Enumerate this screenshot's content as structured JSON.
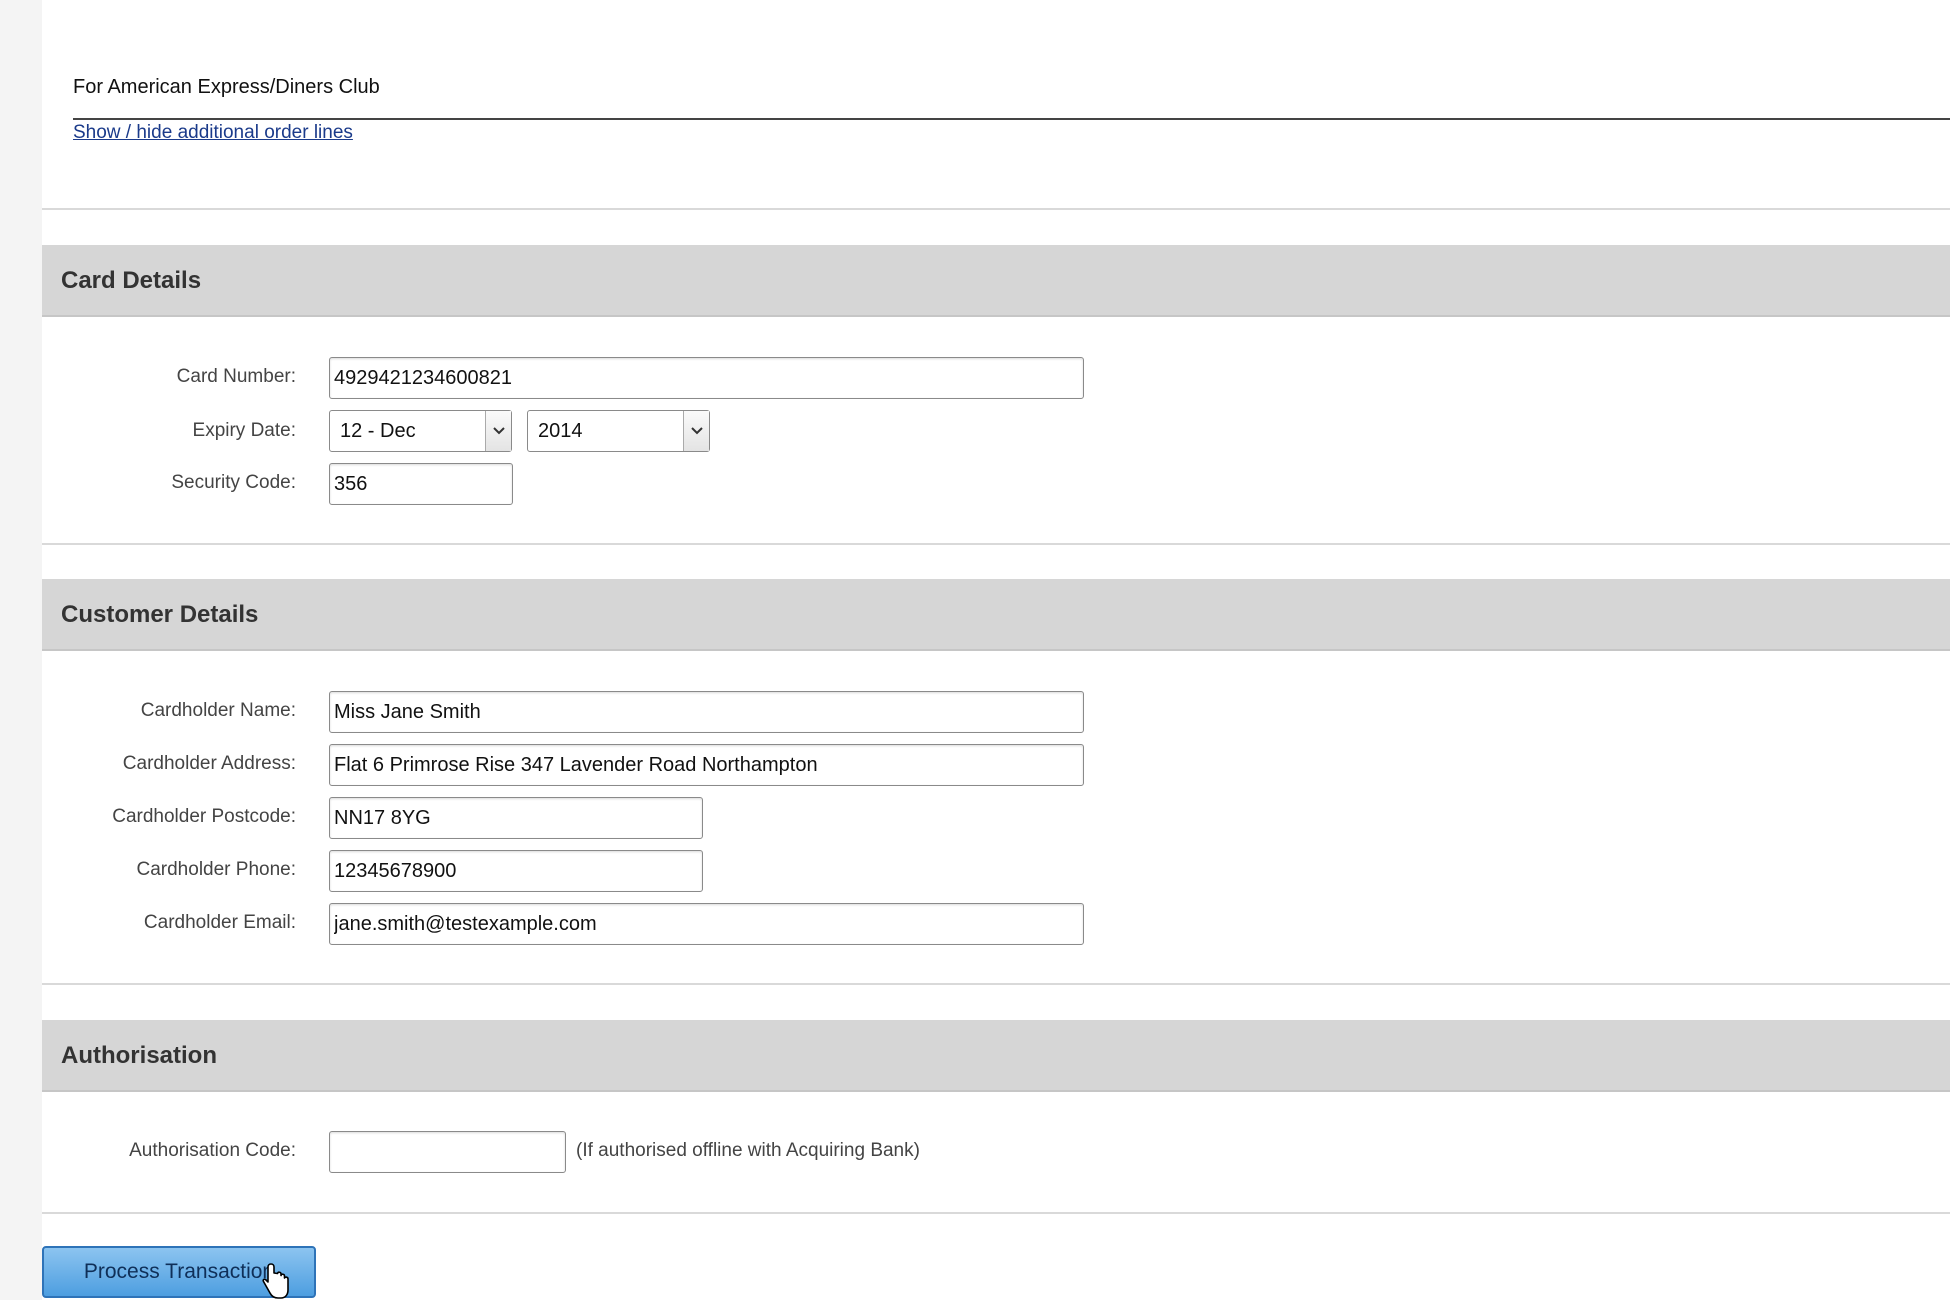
{
  "order": {
    "note": "For American Express/Diners Club",
    "toggle_link": "Show / hide additional order lines"
  },
  "card_details": {
    "title": "Card Details",
    "card_number_label": "Card Number:",
    "card_number_value": "4929421234600821",
    "expiry_label": "Expiry Date:",
    "expiry_month": "12 - Dec",
    "expiry_year": "2014",
    "security_label": "Security Code:",
    "security_value": "356"
  },
  "customer_details": {
    "title": "Customer Details",
    "name_label": "Cardholder Name:",
    "name_value": "Miss Jane Smith",
    "address_label": "Cardholder Address:",
    "address_value": "Flat 6 Primrose Rise 347 Lavender Road Northampton",
    "postcode_label": "Cardholder Postcode:",
    "postcode_value": "NN17 8YG",
    "phone_label": "Cardholder Phone:",
    "phone_value": "12345678900",
    "email_label": "Cardholder Email:",
    "email_value": "jane.smith@testexample.com"
  },
  "authorisation": {
    "title": "Authorisation",
    "code_label": "Authorisation Code:",
    "code_value": "",
    "hint": "(If authorised offline with Acquiring Bank)"
  },
  "actions": {
    "process_label": "Process Transaction"
  },
  "icons": {
    "dropdown": "chevron-down-icon",
    "cursor": "hand-pointer-icon"
  },
  "colors": {
    "section_header_bg": "#d6d6d6",
    "button_bg": "#4d9ee0",
    "link": "#1a3a8a"
  }
}
